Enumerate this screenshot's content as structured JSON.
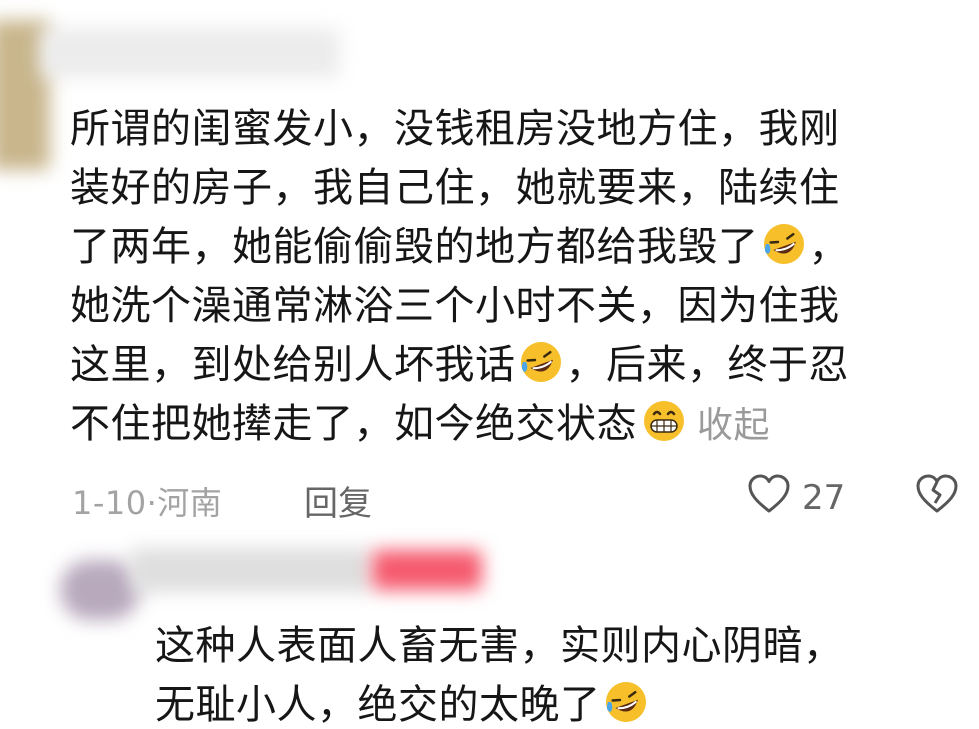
{
  "comment_1": {
    "lines": [
      "所谓的闺蜜发小，没钱租房没地方住，我刚",
      "装好的房子，我自己住，她就要来，陆续住",
      "了两年，她能偷偷毁的地方都给我毁了",
      "她洗个澡通常淋浴三个小时不关，因为住我",
      "这里，到处给别人坏我话",
      "不住把她撵走了，如今绝交状态"
    ],
    "line3_tail": "，",
    "line5_tail": "，后来，终于忍",
    "collapse_label": "收起",
    "date_location": "1-10·河南",
    "reply_label": "回复",
    "like_count": "27"
  },
  "comment_2": {
    "lines": [
      "这种人表面人畜无害，实则内心阴暗，",
      "无耻小人，绝交的太晚了"
    ]
  },
  "icons": {
    "laughing_emoji": "rolling-on-floor-laughing",
    "grin_emoji": "grinning-face",
    "like": "heart-outline",
    "dislike": "broken-heart-outline"
  },
  "colors": {
    "text": "#161616",
    "muted": "#a3a3a3",
    "emoji_yellow": "#f7bf2a",
    "emoji_blue": "#4aa6e8"
  }
}
